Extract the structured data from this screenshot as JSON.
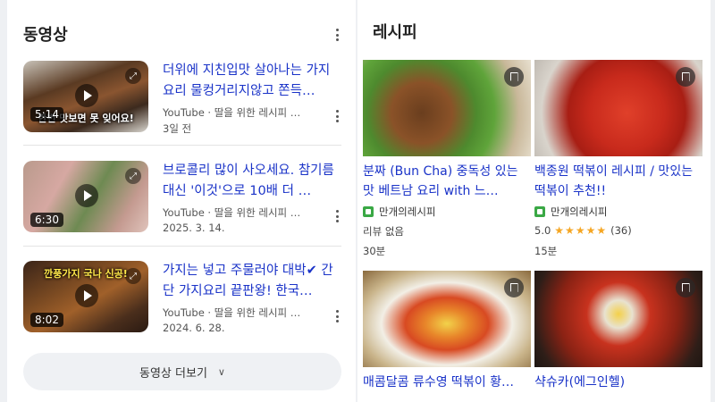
{
  "videos_section": {
    "title": "동영상",
    "more_button": "동영상 더보기",
    "items": [
      {
        "title": "더위에 지친입맛 살아나는 가지요리 물컹거리지않고 쫀득…",
        "source": "YouTube · 딸을 위한 레시피 …",
        "date": "3일 전",
        "duration": "5:14",
        "caption": "한번 맛보면 못 잊어요!"
      },
      {
        "title": "브로콜리 많이 사오세요. 참기름 대신 '이것'으로 10배 더 …",
        "source": "YouTube · 딸을 위한 레시피 …",
        "date": "2025. 3. 14.",
        "duration": "6:30",
        "caption": ""
      },
      {
        "title": "가지는 넣고 주물러야 대박✔ 간단 가지요리 끝판왕! 한국…",
        "source": "YouTube · 딸을 위한 레시피 …",
        "date": "2024. 6. 28.",
        "duration": "8:02",
        "caption": "깐풍가지 국나 신공!"
      }
    ]
  },
  "recipes_section": {
    "title": "레시피",
    "items": [
      {
        "name": "분짜 (Bun Cha) 중독성 있는 맛 베트남 요리 with 느…",
        "source": "만개의레시피",
        "review": "리뷰 없음",
        "rating": "",
        "rating_count": "",
        "time": "30분"
      },
      {
        "name": "백종원 떡볶이 레시피 / 맛있는 떡볶이 추천!!",
        "source": "만개의레시피",
        "review": "",
        "rating": "5.0",
        "rating_count": "(36)",
        "time": "15분"
      },
      {
        "name": "매콤달콤 류수영 떡볶이 황…",
        "source": "",
        "review": "",
        "time": ""
      },
      {
        "name": "샥슈카(에그인헬)",
        "source": "",
        "review": "",
        "time": ""
      }
    ]
  },
  "icons": {
    "kebab": "kebab-menu-icon",
    "play": "play-icon",
    "bookmark": "bookmark-icon",
    "chevron": "chevron-down-icon"
  },
  "colors": {
    "link_blue": "#1a33c8",
    "star": "#f5a623",
    "source_green": "#3aa845"
  }
}
